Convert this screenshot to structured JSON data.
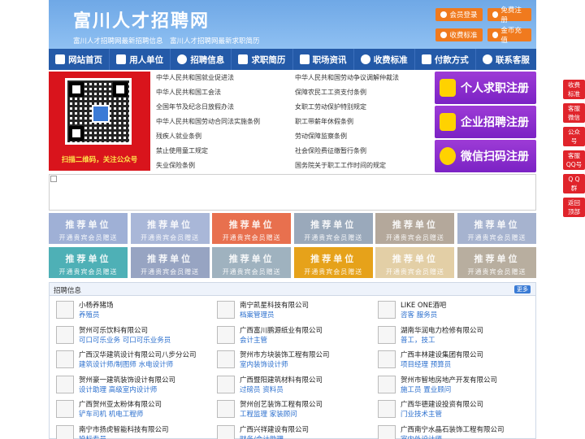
{
  "header": {
    "title": "富川人才招聘网",
    "subtitle": "富川人才招聘网最新招聘信息　富川人才招聘网最新求职简历",
    "buttons": [
      "会员登录",
      "免费注册",
      "收费标准",
      "金币充值"
    ]
  },
  "nav": [
    "网站首页",
    "用人单位",
    "招聘信息",
    "求职简历",
    "职场资讯",
    "收费标准",
    "付款方式",
    "联系客服"
  ],
  "qr": {
    "caption": "扫描二维码，关注公众号"
  },
  "links": {
    "left": [
      "中华人民共和国就业促进法",
      "中华人民共和国工会法",
      "全国年节及纪念日放假办法",
      "中华人民共和国劳动合同法实施条例",
      "残疾人就业条例",
      "禁止使用童工规定",
      "失业保险条例"
    ],
    "right": [
      "中华人民共和国劳动争议调解仲裁法",
      "保障农民工工资支付条例",
      "女职工劳动保护特别规定",
      "职工带薪年休假条例",
      "劳动保障监察条例",
      "社会保险费征缴暂行条例",
      "国务院关于职工工作时间的规定"
    ]
  },
  "register": [
    "个人求职注册",
    "企业招聘注册",
    "微信扫码注册"
  ],
  "recommend": {
    "title": "推荐单位",
    "subtitle": "开通贵宾会员赠送",
    "colors": [
      "#9fb0d6",
      "#a9b7d8",
      "#e8704e",
      "#9aa9bb",
      "#b4a89b",
      "#a6b3cf",
      "#4eb0b6",
      "#97a4c2",
      "#9fb2bf",
      "#e6a21a",
      "#e3cfa6",
      "#b8ae9f"
    ]
  },
  "jobs": {
    "title": "招聘信息",
    "more": "更多",
    "items": [
      {
        "company": "小杨养猪场",
        "positions": "养殖员"
      },
      {
        "company": "南宁凯星科技有限公司",
        "positions": "档案管理员"
      },
      {
        "company": "LIKE ONE酒吧",
        "positions": "咨客 服务员"
      },
      {
        "company": "贺州可乐饮料有限公司",
        "positions": "可口可乐业务 可口可乐业务员"
      },
      {
        "company": "广西富川鹏源纸业有限公司",
        "positions": "会计主管"
      },
      {
        "company": "湖南华润电力检修有限公司",
        "positions": "普工，技工"
      },
      {
        "company": "广西汉华建筑设计有限公司八步分公司",
        "positions": "建筑设计师/制图师 水电设计师"
      },
      {
        "company": "贺州市方块装饰工程有限公司",
        "positions": "室内装饰设计师"
      },
      {
        "company": "广西丰林建设集团有限公司",
        "positions": "项目经理 预算员"
      },
      {
        "company": "贺州豪一建筑装饰设计有限公司",
        "positions": "设计助理 高级室内设计师"
      },
      {
        "company": "广西暨阳建筑材料有限公司",
        "positions": "过磅员 资料员"
      },
      {
        "company": "贺州市智地房地产开发有限公司",
        "positions": "施工员 置业顾问"
      },
      {
        "company": "广西贺州亚太粉体有限公司",
        "positions": "铲车司机 机电工程师"
      },
      {
        "company": "贺州创艺装饰工程有限公司",
        "positions": "工程监理 家装顾问"
      },
      {
        "company": "广西华德建设投资有限公司",
        "positions": "门业技术主管"
      },
      {
        "company": "南宁市扬虎智能科技有限公司",
        "positions": "投标专员"
      },
      {
        "company": "广西兴祥建设有限公司",
        "positions": "财务/会计助理"
      },
      {
        "company": "广西南宁水晶石装饰工程有限公司",
        "positions": "室内外设计师"
      }
    ]
  },
  "side": [
    [
      "收费",
      "标准"
    ],
    [
      "客服",
      "微信"
    ],
    [
      "公众",
      "号"
    ],
    [
      "客服",
      "QQ号"
    ],
    [
      "Q Q",
      "群"
    ],
    [
      "返回",
      "顶部"
    ]
  ]
}
